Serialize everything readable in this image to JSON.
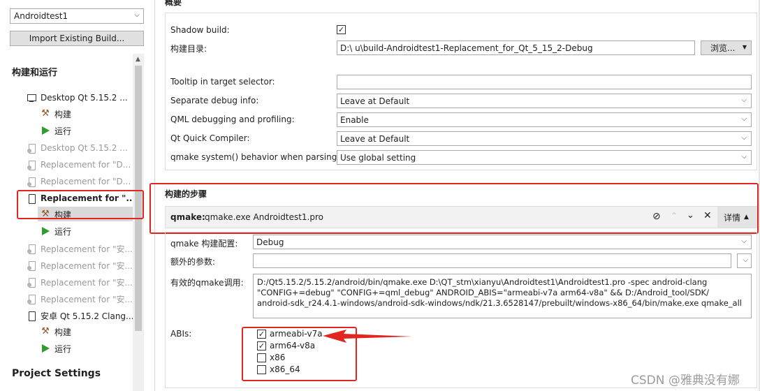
{
  "sidebar": {
    "kit_combo": "Androidtest1",
    "import_button": "Import Existing Build...",
    "section_title": "构建和运行",
    "items": [
      {
        "label": "Desktop Qt 5.15.2 ...",
        "kind": "kit"
      },
      {
        "label": "构建",
        "kind": "build"
      },
      {
        "label": "运行",
        "kind": "run"
      },
      {
        "label": "Desktop Qt 5.15.2 ...",
        "kind": "kit-dim"
      },
      {
        "label": "Replacement for \"D...",
        "kind": "kit-dim"
      },
      {
        "label": "Replacement for \"D...",
        "kind": "kit-dim"
      },
      {
        "label": "Replacement for \"...",
        "kind": "kit-active"
      },
      {
        "label": "构建",
        "kind": "build-selected"
      },
      {
        "label": "运行",
        "kind": "run"
      },
      {
        "label": "Replacement for \"安...",
        "kind": "kit-dim"
      },
      {
        "label": "Replacement for \"安...",
        "kind": "kit-dim"
      },
      {
        "label": "Replacement for \"安...",
        "kind": "kit-dim"
      },
      {
        "label": "Replacement for \"安...",
        "kind": "kit-dim"
      },
      {
        "label": "安卓 Qt 5.15.2 Clang...",
        "kind": "kit"
      },
      {
        "label": "构建",
        "kind": "build"
      },
      {
        "label": "运行",
        "kind": "run"
      }
    ],
    "project_settings": "Project Settings"
  },
  "general": {
    "title": "概要",
    "shadow_build_label": "Shadow build:",
    "shadow_build_checked": true,
    "build_dir_label": "构建目录:",
    "build_dir_value": "D:\\        u\\build-Androidtest1-Replacement_for_Qt_5_15_2-Debug",
    "browse_button": "浏览...",
    "tooltip_label": "Tooltip in target selector:",
    "tooltip_value": "",
    "separate_debug_label": "Separate debug info:",
    "separate_debug_value": "Leave at Default",
    "qml_debug_label": "QML debugging and profiling:",
    "qml_debug_value": "Enable",
    "qt_quick_label": "Qt Quick Compiler:",
    "qt_quick_value": "Leave at Default",
    "qmake_behavior_label": "qmake system() behavior when parsing:",
    "qmake_behavior_value": "Use global setting"
  },
  "build_steps": {
    "title": "构建的步骤",
    "step_name": "qmake:",
    "step_cmd": "qmake.exe Androidtest1.pro",
    "details_button": "详情",
    "config_label": "qmake 构建配置:",
    "config_value": "Debug",
    "extra_args_label": "额外的参数:",
    "extra_args_value": "",
    "effective_label": "有效的qmake调用:",
    "effective_lines": [
      "D:/Qt5.15.2/5.15.2/android/bin/qmake.exe D:\\QT_stm\\xianyu\\Androidtest1\\Androidtest1.pro -spec android-clang",
      "\"CONFIG+=debug\" \"CONFIG+=qml_debug\" ANDROID_ABIS=\"armeabi-v7a arm64-v8a\" && D:/Android_tool/SDK/",
      "android-sdk_r24.4.1-windows/android-sdk-windows/ndk/21.3.6528147/prebuilt/windows-x86_64/bin/make.exe qmake_all"
    ],
    "abis_label": "ABIs:",
    "abis": [
      {
        "name": "armeabi-v7a",
        "checked": true
      },
      {
        "name": "arm64-v8a",
        "checked": true
      },
      {
        "name": "x86",
        "checked": false
      },
      {
        "name": "x86_64",
        "checked": false
      }
    ]
  },
  "watermark": "CSDN @雅典没有娜",
  "colors": {
    "highlight_red": "#e0261e",
    "run_green": "#2e9d2e"
  }
}
